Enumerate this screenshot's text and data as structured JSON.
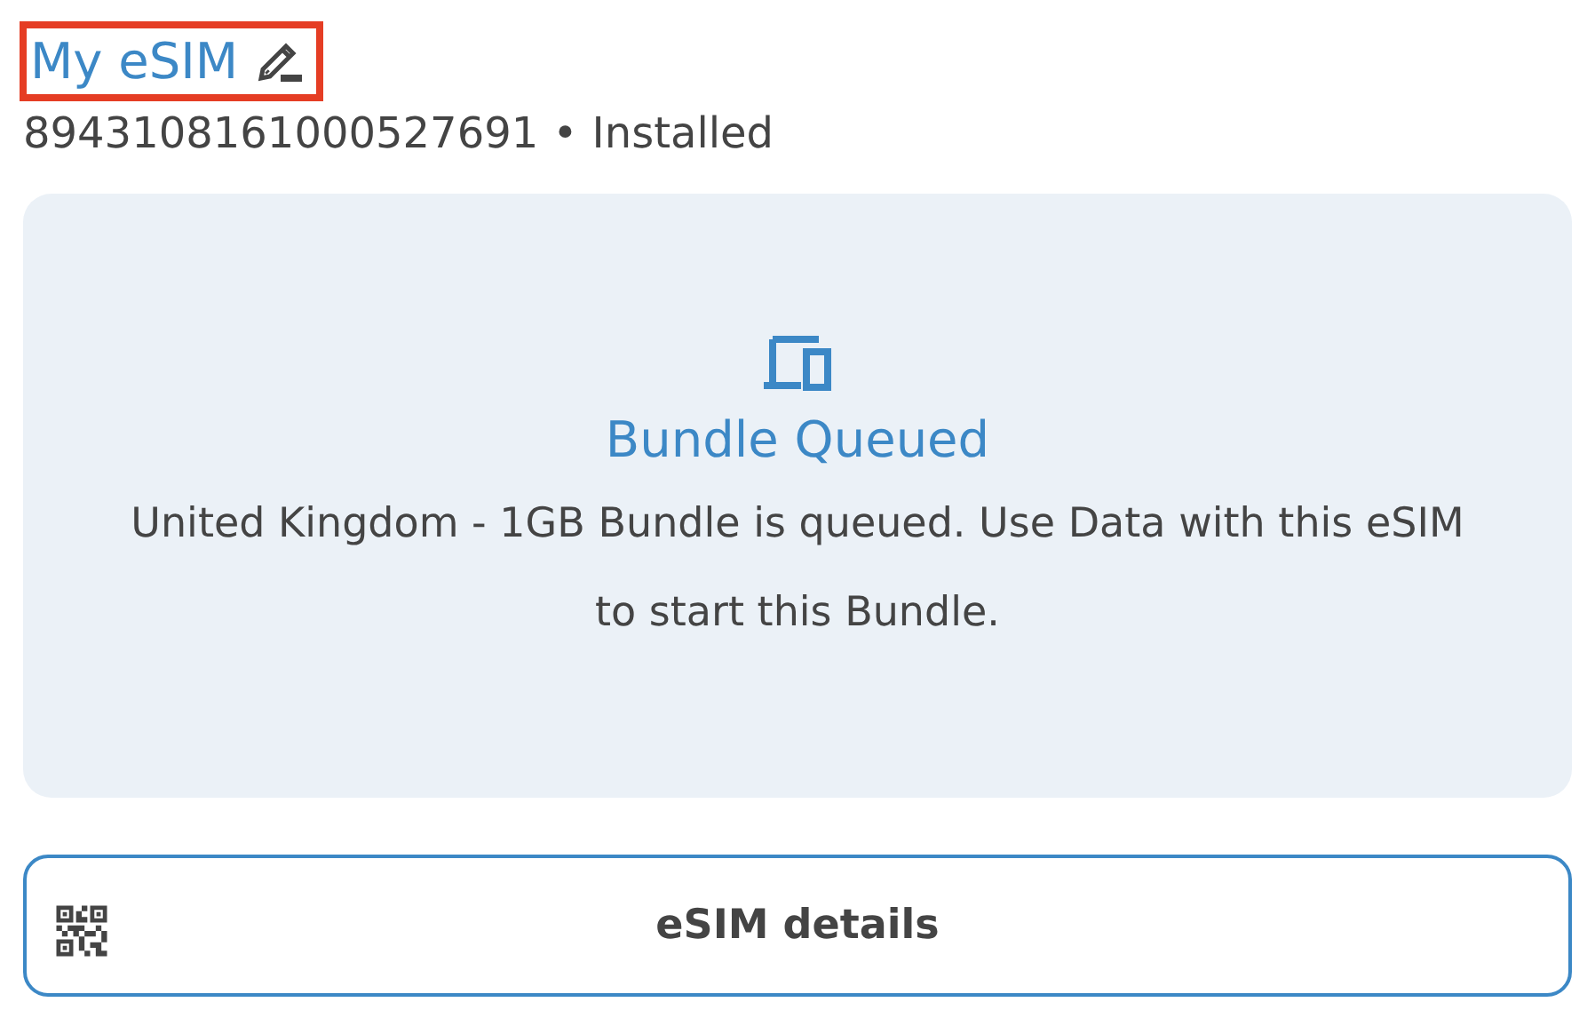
{
  "esim": {
    "name": "My eSIM",
    "highlighted": true,
    "iccid": "8943108161000527691",
    "separator": "•",
    "status": "Installed"
  },
  "bundle_card": {
    "title": "Bundle Queued",
    "message": "United Kingdom - 1GB Bundle is queued. Use Data with this eSIM to start this Bundle."
  },
  "details_button": {
    "label": "eSIM details"
  }
}
